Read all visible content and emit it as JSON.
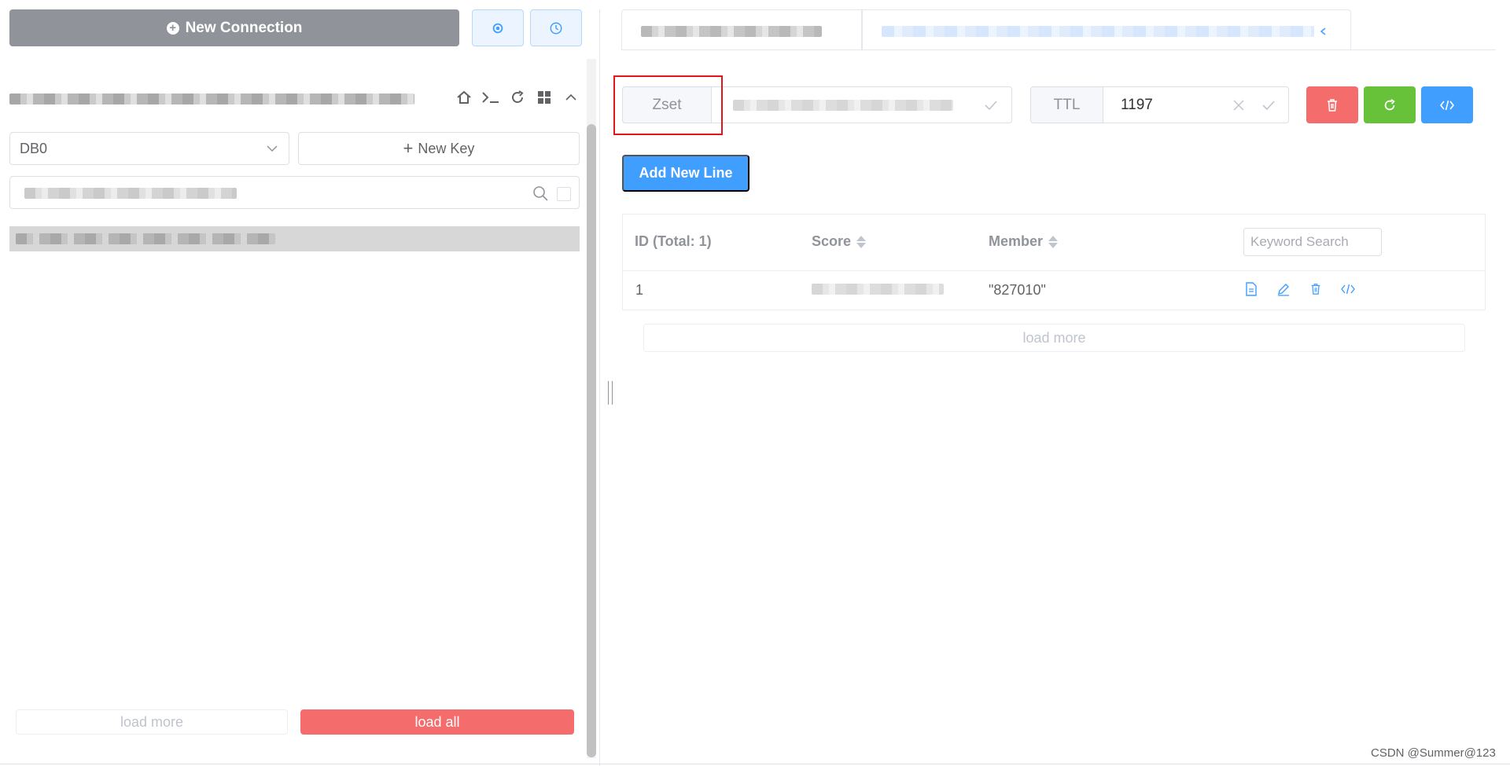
{
  "left": {
    "new_connection_label": "New Connection",
    "db_select_value": "DB0",
    "new_key_label": "New Key",
    "load_more_label": "load more",
    "load_all_label": "load all"
  },
  "detail": {
    "type_label": "Zset",
    "ttl_label": "TTL",
    "ttl_value": "1197",
    "add_new_line_label": "Add New Line",
    "table": {
      "columns": [
        "ID (Total: 1)",
        "Score",
        "Member"
      ],
      "keyword_search_placeholder": "Keyword Search",
      "rows": [
        {
          "id": "1",
          "member": "\"827010\""
        }
      ]
    },
    "load_more_label": "load more"
  },
  "watermark": "CSDN @Summer@123",
  "colors": {
    "danger": "#f56c6c",
    "success": "#67c23a",
    "primary": "#409eff",
    "info": "#909399",
    "highlight": "#e4141b"
  }
}
